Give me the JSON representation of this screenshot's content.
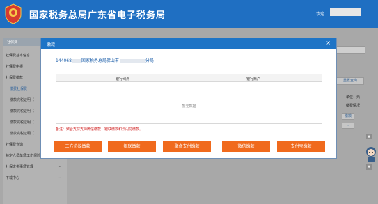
{
  "header": {
    "title": "国家税务总局广东省电子税务局",
    "welcome": "欢迎",
    "colors": {
      "bar": "#1f6fc2",
      "text": "#ffffff"
    }
  },
  "sidebar": {
    "group_title": "社保费",
    "items": [
      {
        "label": "社保费基本信息",
        "sub": false
      },
      {
        "label": "社保费申报",
        "sub": false
      },
      {
        "label": "社保费缴款",
        "sub": false
      },
      {
        "label": "缴费社保费",
        "sub": true,
        "active": true
      },
      {
        "label": "缴款完税证明（",
        "sub": true
      },
      {
        "label": "缴款完税证明（",
        "sub": true
      },
      {
        "label": "缴款完税证明（",
        "sub": true
      },
      {
        "label": "缴款完税证明（",
        "sub": true
      },
      {
        "label": "社保费查询",
        "sub": false
      },
      {
        "label": "特定人员单项工伤保险",
        "sub": false
      },
      {
        "label": "社保文书事项管理",
        "sub": false
      },
      {
        "label": "下载中心",
        "sub": false
      }
    ]
  },
  "right_panel": {
    "button": "重置查询",
    "unit": "单位：元",
    "status": "缴费情况",
    "action": "缴款",
    "more": "..."
  },
  "modal": {
    "title": "缴款",
    "close": "×",
    "tax_office_prefix": "144068",
    "tax_office_mid": "国家税务总局佛山市",
    "tax_office_suffix": "分局",
    "table": {
      "columns": [
        "银行网点",
        "银行账户"
      ],
      "empty_text": "暂无数据"
    },
    "note": "备注：聚合支付支持微信缴款、银联缴款和云闪付缴款。",
    "buttons": [
      "三方协议缴款",
      "银联缴款",
      "聚合支付缴款",
      "微信缴款",
      "支付宝缴款"
    ],
    "colors": {
      "accent": "#1e74c6",
      "button": "#f06a1d",
      "note": "#d02020"
    }
  }
}
